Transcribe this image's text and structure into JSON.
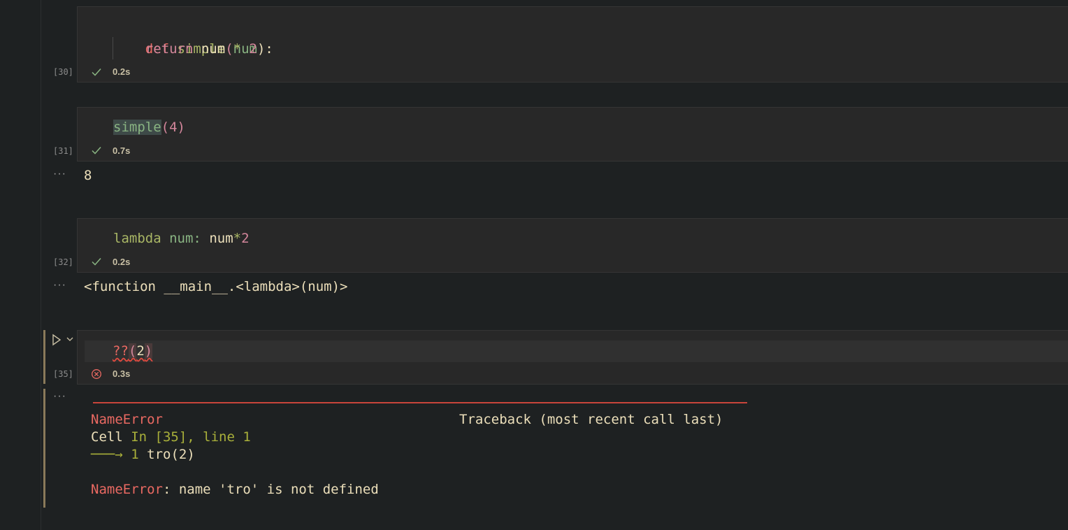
{
  "cells": [
    {
      "exec_count": "[30]",
      "timing": "0.2s",
      "status": "success",
      "code_line1": {
        "kw": "def",
        "fn": "simple",
        "open": "(",
        "param": "num",
        "close": "):"
      },
      "code_line2": {
        "kw": "return",
        "var": "num",
        "op": "*",
        "num": "2"
      }
    },
    {
      "exec_count": "[31]",
      "timing": "0.7s",
      "status": "success",
      "code": {
        "fn": "simple",
        "open": "(",
        "num": "4",
        "close": ")"
      },
      "output": "8"
    },
    {
      "exec_count": "[32]",
      "timing": "0.2s",
      "status": "success",
      "code": {
        "kw": "lambda",
        "param": "num",
        "colon": ":",
        "var": "num",
        "op": "*",
        "num": "2"
      },
      "output": "<function __main__.<lambda>(num)>"
    },
    {
      "exec_count": "[35]",
      "timing": "0.3s",
      "status": "error",
      "code": {
        "q": "??",
        "open": "(",
        "num": "2",
        "close": ")"
      },
      "traceback": {
        "error_name": "NameError",
        "header_right": "Traceback (most recent call last)",
        "cell_label": "Cell",
        "cell_ref": "In [35], line 1",
        "arrow": "───→",
        "line_no": "1",
        "line_code": "tro(2)",
        "final_error": "NameError",
        "final_message": ": name 'tro' is not defined"
      }
    }
  ],
  "output_ellipsis": "···",
  "icons": [
    "check-icon",
    "error-circle-icon",
    "run-cell-icon",
    "chevron-down-icon"
  ],
  "colors": {
    "background": "#1e2121",
    "cell": "#282828",
    "error": "#ea6962",
    "success": "#89b482"
  }
}
